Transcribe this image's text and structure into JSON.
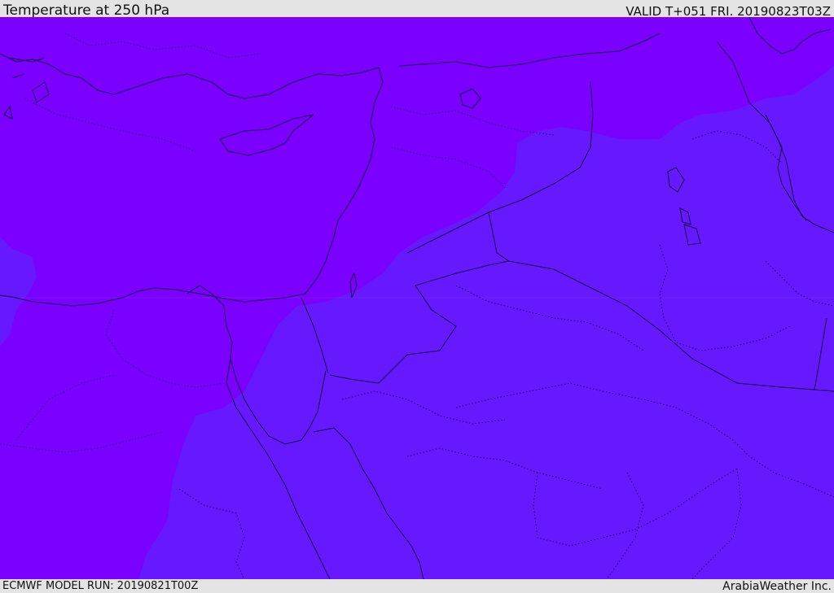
{
  "header": {
    "title": "Temperature at 250 hPa",
    "valid_time": "VALID T+051 FRI. 20190823T03Z"
  },
  "footer": {
    "model_run": "ECMWF MODEL RUN: 20190821T00Z",
    "credit": "ArabiaWeather Inc."
  },
  "map": {
    "field": "temperature",
    "level": "250 hPa",
    "colors": {
      "warm_zone": "#7a00ff",
      "cool_zone": "#6618ff",
      "coastline": "#1a0040",
      "border": "#1a0040"
    }
  }
}
